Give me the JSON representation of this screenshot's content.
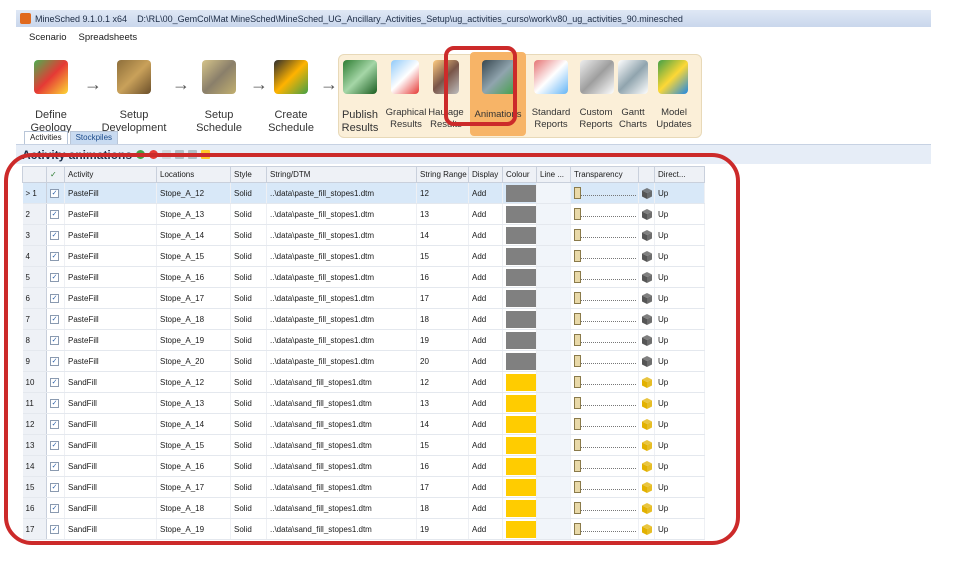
{
  "window": {
    "app_title": "MineSched 9.1.0.1 x64",
    "file_path": "D:\\RL\\00_GemCol\\Mat MineSched\\MineSched_UG_Ancillary_Activities_Setup\\ug_activities_curso\\work\\v80_ug_activities_90.minesched"
  },
  "menu": {
    "items": [
      "Scenario",
      "Spreadsheets"
    ]
  },
  "ribbon": {
    "define_geology": "Define\nGeology",
    "setup_development": "Setup\nDevelopment",
    "setup_schedule": "Setup\nSchedule",
    "create_schedule": "Create\nSchedule",
    "publish_results": "Publish\nResults",
    "graphical_results": "Graphical\nResults",
    "haulage_results": "Haulage\nResults",
    "animations": "Animations",
    "standard_reports": "Standard\nReports",
    "custom_reports": "Custom\nReports",
    "gantt_charts": "Gantt\nCharts",
    "model_updates": "Model\nUpdates"
  },
  "tabs": [
    "Activities",
    "Stockpiles"
  ],
  "pane_title": "Activity animations",
  "grid": {
    "columns": [
      "",
      "✓",
      "Activity",
      "Locations",
      "Style",
      "String/DTM",
      "String Range",
      "Display",
      "Colour",
      "Line ...",
      "Transparency",
      "",
      "Direct..."
    ],
    "rows": [
      {
        "num": "1",
        "activity": "PasteFill",
        "location": "Stope_A_12",
        "style": "Solid",
        "dtm": "..\\data\\paste_fill_stopes1.dtm",
        "range": "12",
        "display": "Add",
        "direction": "Up"
      },
      {
        "num": "2",
        "activity": "PasteFill",
        "location": "Stope_A_13",
        "style": "Solid",
        "dtm": "..\\data\\paste_fill_stopes1.dtm",
        "range": "13",
        "display": "Add",
        "direction": "Up"
      },
      {
        "num": "3",
        "activity": "PasteFill",
        "location": "Stope_A_14",
        "style": "Solid",
        "dtm": "..\\data\\paste_fill_stopes1.dtm",
        "range": "14",
        "display": "Add",
        "direction": "Up"
      },
      {
        "num": "4",
        "activity": "PasteFill",
        "location": "Stope_A_15",
        "style": "Solid",
        "dtm": "..\\data\\paste_fill_stopes1.dtm",
        "range": "15",
        "display": "Add",
        "direction": "Up"
      },
      {
        "num": "5",
        "activity": "PasteFill",
        "location": "Stope_A_16",
        "style": "Solid",
        "dtm": "..\\data\\paste_fill_stopes1.dtm",
        "range": "16",
        "display": "Add",
        "direction": "Up"
      },
      {
        "num": "6",
        "activity": "PasteFill",
        "location": "Stope_A_17",
        "style": "Solid",
        "dtm": "..\\data\\paste_fill_stopes1.dtm",
        "range": "17",
        "display": "Add",
        "direction": "Up"
      },
      {
        "num": "7",
        "activity": "PasteFill",
        "location": "Stope_A_18",
        "style": "Solid",
        "dtm": "..\\data\\paste_fill_stopes1.dtm",
        "range": "18",
        "display": "Add",
        "direction": "Up"
      },
      {
        "num": "8",
        "activity": "PasteFill",
        "location": "Stope_A_19",
        "style": "Solid",
        "dtm": "..\\data\\paste_fill_stopes1.dtm",
        "range": "19",
        "display": "Add",
        "direction": "Up"
      },
      {
        "num": "9",
        "activity": "PasteFill",
        "location": "Stope_A_20",
        "style": "Solid",
        "dtm": "..\\data\\paste_fill_stopes1.dtm",
        "range": "20",
        "display": "Add",
        "direction": "Up"
      },
      {
        "num": "10",
        "activity": "SandFill",
        "location": "Stope_A_12",
        "style": "Solid",
        "dtm": "..\\data\\sand_fill_stopes1.dtm",
        "range": "12",
        "display": "Add",
        "direction": "Up"
      },
      {
        "num": "11",
        "activity": "SandFill",
        "location": "Stope_A_13",
        "style": "Solid",
        "dtm": "..\\data\\sand_fill_stopes1.dtm",
        "range": "13",
        "display": "Add",
        "direction": "Up"
      },
      {
        "num": "12",
        "activity": "SandFill",
        "location": "Stope_A_14",
        "style": "Solid",
        "dtm": "..\\data\\sand_fill_stopes1.dtm",
        "range": "14",
        "display": "Add",
        "direction": "Up"
      },
      {
        "num": "13",
        "activity": "SandFill",
        "location": "Stope_A_15",
        "style": "Solid",
        "dtm": "..\\data\\sand_fill_stopes1.dtm",
        "range": "15",
        "display": "Add",
        "direction": "Up"
      },
      {
        "num": "14",
        "activity": "SandFill",
        "location": "Stope_A_16",
        "style": "Solid",
        "dtm": "..\\data\\sand_fill_stopes1.dtm",
        "range": "16",
        "display": "Add",
        "direction": "Up"
      },
      {
        "num": "15",
        "activity": "SandFill",
        "location": "Stope_A_17",
        "style": "Solid",
        "dtm": "..\\data\\sand_fill_stopes1.dtm",
        "range": "17",
        "display": "Add",
        "direction": "Up"
      },
      {
        "num": "16",
        "activity": "SandFill",
        "location": "Stope_A_18",
        "style": "Solid",
        "dtm": "..\\data\\sand_fill_stopes1.dtm",
        "range": "18",
        "display": "Add",
        "direction": "Up"
      },
      {
        "num": "17",
        "activity": "SandFill",
        "location": "Stope_A_19",
        "style": "Solid",
        "dtm": "..\\data\\sand_fill_stopes1.dtm",
        "range": "19",
        "display": "Add",
        "direction": "Up"
      }
    ]
  },
  "colors": {
    "pastefill": "#808080",
    "sandfill": "#ffcc00",
    "highlight": "#cc2a2a",
    "pastefill_cube": "#555555",
    "sandfill_cube": "#e2b100"
  }
}
